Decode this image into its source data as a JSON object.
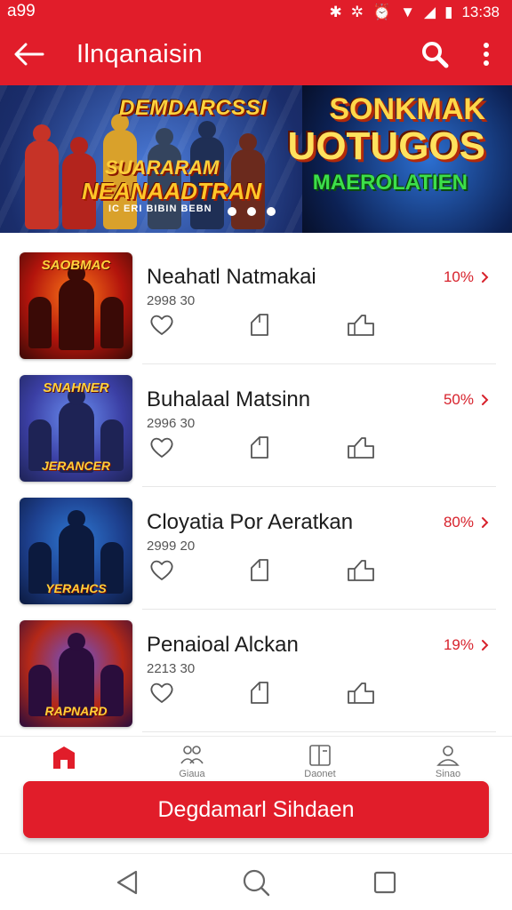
{
  "status_bar": {
    "carrier": "a99",
    "time": "13:38",
    "icons": [
      "bluetooth-icon",
      "vibrate-icon",
      "alarm-icon",
      "wifi-icon",
      "signal-icon",
      "battery-icon"
    ]
  },
  "app_bar": {
    "title": "Ilnqanaisin",
    "icons": [
      "back-arrow-icon",
      "search-icon",
      "more-vertical-icon"
    ]
  },
  "banner": {
    "line_top": "DEMDARCSSI",
    "line_mid": "SUARARAM",
    "line_big": "NEANAADTRAN",
    "line_small": "IC ERI BIBIN BEBN",
    "right_line1": "SONKMAK",
    "right_line2": "UOTUGOS",
    "right_line3": "MAEROLATIEN",
    "dots": 3
  },
  "games": [
    {
      "title": "Neahatl Natmakai",
      "subtitle": "2998 30",
      "percent": "10%",
      "thumb_title": "SAOBMAC",
      "thumb_sub": "",
      "colors": [
        "#ff7a18",
        "#b2140c",
        "#3a0a06"
      ]
    },
    {
      "title": "Buhalaal Matsinn",
      "subtitle": "2996 30",
      "percent": "50%",
      "thumb_title": "SNAHNER",
      "thumb_sub": "JERANCER",
      "colors": [
        "#6a8ff2",
        "#3b3fa4",
        "#1e2355"
      ]
    },
    {
      "title": "Cloyatia Por Aeratkan",
      "subtitle": "2999 20",
      "percent": "80%",
      "thumb_title": "",
      "thumb_sub": "YERAHCS",
      "colors": [
        "#2f79d4",
        "#1d3f8d",
        "#0c1a3e"
      ]
    },
    {
      "title": "Penaioal Alckan",
      "subtitle": "2213 30",
      "percent": "19%",
      "thumb_title": "",
      "thumb_sub": "RAPNARD",
      "colors": [
        "#6a55d8",
        "#b42818",
        "#2a0d3c"
      ]
    }
  ],
  "row_icons": [
    "heart-icon",
    "tag-icon",
    "share-icon"
  ],
  "bottom_nav": [
    {
      "label": "",
      "icon": "home-icon",
      "active": true
    },
    {
      "label": "Giaua",
      "icon": "group-icon",
      "active": false
    },
    {
      "label": "Daonet",
      "icon": "library-icon",
      "active": false
    },
    {
      "label": "Sinao",
      "icon": "profile-icon",
      "active": false
    }
  ],
  "cta": {
    "label": "Degdamarl Sihdaen"
  },
  "system_nav": [
    "back-triangle-icon",
    "home-search-icon",
    "recents-square-icon"
  ],
  "colors": {
    "primary": "#e11d2a",
    "accent_text": "#d7222c",
    "text": "#1c1c1c"
  }
}
